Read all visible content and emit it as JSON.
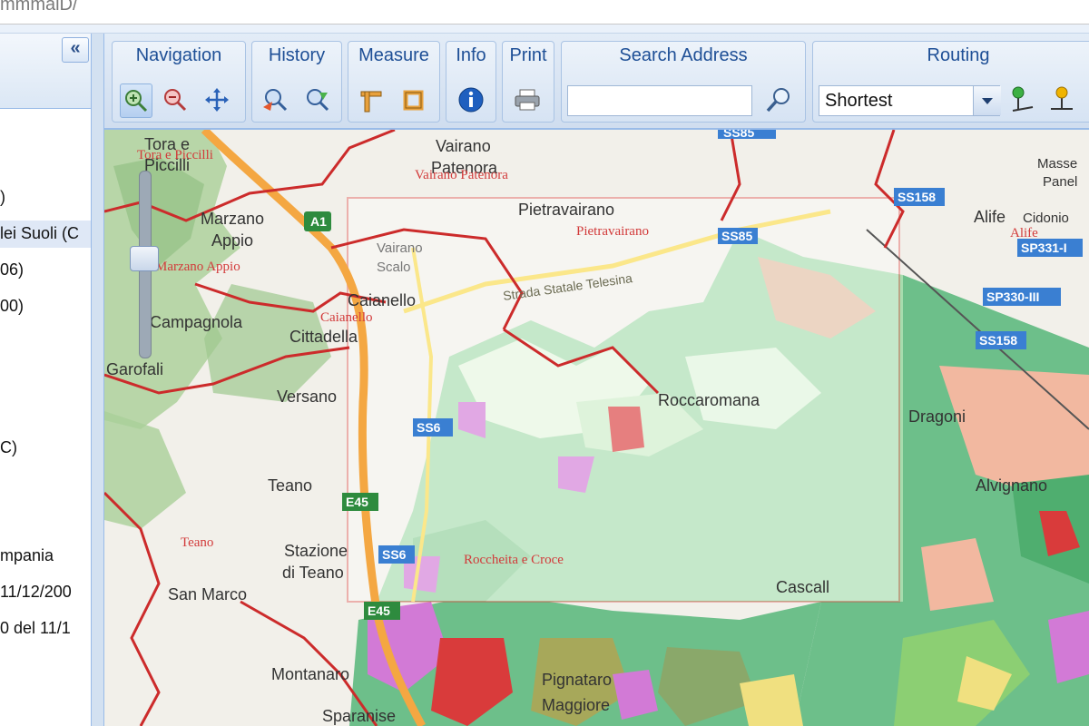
{
  "url_fragment": "mmmaiD/",
  "left_panel": {
    "lines": [
      ")",
      "lei Suoli (C",
      "06)",
      "00)",
      "C)",
      "mpania",
      "11/12/200",
      "0 del 11/1"
    ],
    "collapse_glyph": "«"
  },
  "toolbar": {
    "groups": {
      "navigation": "Navigation",
      "history": "History",
      "measure": "Measure",
      "info": "Info",
      "print": "Print",
      "search": "Search Address",
      "routing": "Routing"
    },
    "search": {
      "value": "",
      "placeholder": ""
    },
    "routing": {
      "mode": "Shortest"
    }
  },
  "map": {
    "zoom_level_fraction": 0.55,
    "places": [
      "Tora e",
      "Piccilli",
      "Vairano",
      "Patenora",
      "Pietravairano",
      "Marzano",
      "Appio",
      "Caianello",
      "Cittadella",
      "Campagnola",
      "Versano",
      "Teano",
      "Stazione",
      "di Teano",
      "San Marco",
      "Montanaro",
      "Sparanise",
      "Pignataro",
      "Maggiore",
      "Alife",
      "Cidonio",
      "Masse",
      "Panel",
      "Roccaromana",
      "Vairano",
      "Scalo",
      "Garofali",
      "Dragoni",
      "Alvignano",
      "Cascall"
    ],
    "red_labels": [
      "Tora e Piccilli",
      "Vairano Patenora",
      "Pietravairano",
      "Marzano Appio",
      "Caianello",
      "Teano",
      "Alife",
      "Roccheita e Croce"
    ],
    "road_shields": [
      "A1",
      "SS158",
      "SS158",
      "SP331-I",
      "SP330-III",
      "SS6",
      "SS6",
      "E45",
      "SS85",
      "SS85",
      "E45"
    ],
    "road_labels": [
      "Strada Statale Telesina"
    ],
    "colors": {
      "selection_border": "#e23c3c",
      "forest": "#9ec78f",
      "soil_green": "#6dbf8a",
      "soil_pink": "#f2b8a0",
      "soil_purple": "#d27ad6",
      "soil_red": "#d93b3b",
      "road_major": "#f4a742",
      "boundary": "#cc2b2b",
      "shield": "#3a7fd2"
    }
  }
}
